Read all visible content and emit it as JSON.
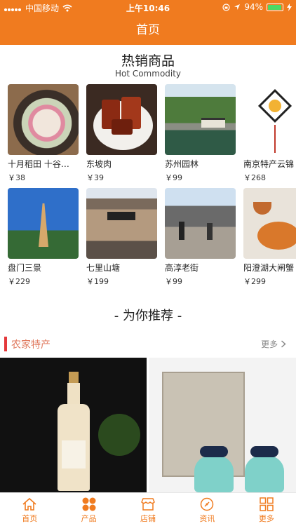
{
  "status": {
    "carrier": "中国移动",
    "time": "上午10:46",
    "battery": "94%"
  },
  "header": {
    "title": "首页"
  },
  "hot": {
    "title": "热销商品",
    "subtitle": "Hot Commodity"
  },
  "products": [
    {
      "name": "十月稻田 十谷…",
      "price": "￥38"
    },
    {
      "name": "东坡肉",
      "price": "￥39"
    },
    {
      "name": "苏州园林",
      "price": "￥99"
    },
    {
      "name": "南京特产云锦",
      "price": "￥268"
    },
    {
      "name": "盘门三景",
      "price": "￥229"
    },
    {
      "name": "七里山塘",
      "price": "￥199"
    },
    {
      "name": "高淳老街",
      "price": "￥99"
    },
    {
      "name": "阳澄湖大闸蟹",
      "price": "￥299"
    }
  ],
  "recommend": {
    "title": "- 为你推荐 -"
  },
  "category": {
    "title": "农家特产",
    "more": "更多"
  },
  "tabbar": [
    {
      "label": "首页",
      "icon": "home-icon"
    },
    {
      "label": "产品",
      "icon": "products-icon"
    },
    {
      "label": "店铺",
      "icon": "shop-icon"
    },
    {
      "label": "资讯",
      "icon": "news-icon"
    },
    {
      "label": "更多",
      "icon": "more-grid-icon"
    }
  ],
  "colors": {
    "accent": "#f07b1f",
    "category_bar": "#e4393c",
    "battery": "#4cd964"
  }
}
